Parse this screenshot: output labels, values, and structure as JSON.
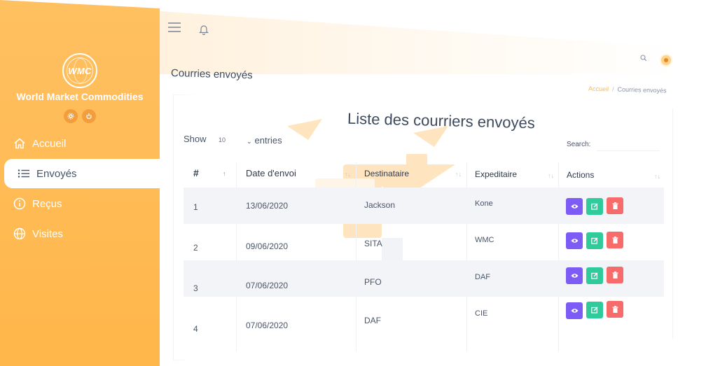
{
  "sidebar": {
    "logo_text": "WMC",
    "brand_name": "World Market Commodities",
    "items": [
      {
        "label": "Accueil"
      },
      {
        "label": "Envoyés"
      },
      {
        "label": "Reçus"
      },
      {
        "label": "Visites"
      }
    ]
  },
  "header": {
    "page_title": "Courries envoyés",
    "breadcrumb": {
      "home": "Accueil",
      "sep": "/",
      "current": "Courries envoyés"
    }
  },
  "card": {
    "title": "Liste des courriers envoyés",
    "show_label": "Show",
    "show_value": "10",
    "entries_label": "entries",
    "search_label": "Search:"
  },
  "table": {
    "columns": [
      "#",
      "Date d'envoi",
      "Destinataire",
      "Expeditaire",
      "Actions"
    ],
    "rows": [
      {
        "num": "1",
        "date": "13/06/2020",
        "dest": "Jackson",
        "exp": "Kone"
      },
      {
        "num": "2",
        "date": "09/06/2020",
        "dest": "SITA",
        "exp": "WMC"
      },
      {
        "num": "3",
        "date": "07/06/2020",
        "dest": "PFO",
        "exp": "DAF"
      },
      {
        "num": "4",
        "date": "07/06/2020",
        "dest": "DAF",
        "exp": "CIE"
      }
    ]
  },
  "colors": {
    "sidebar": "#ffb64a",
    "accent_view": "#7c5cf5",
    "accent_edit": "#2ecc9a",
    "accent_delete": "#f76b6b"
  }
}
